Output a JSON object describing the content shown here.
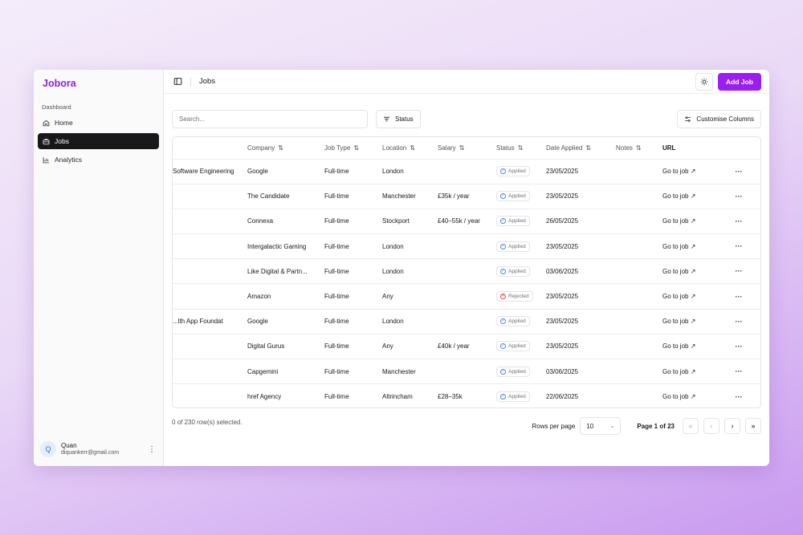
{
  "app": {
    "brand": "Jobora",
    "accent": "#9a1ef0"
  },
  "sidebar": {
    "section_label": "Dashboard",
    "items": [
      {
        "label": "Home",
        "icon": "home-icon"
      },
      {
        "label": "Jobs",
        "icon": "briefcase-icon",
        "active": true
      },
      {
        "label": "Analytics",
        "icon": "chart-icon"
      }
    ],
    "user": {
      "initial": "Q",
      "name": "Quan",
      "email": "diquankerr@gmail.com"
    }
  },
  "header": {
    "title": "Jobs",
    "add_label": "Add Job"
  },
  "toolbar": {
    "search_placeholder": "Search...",
    "status_label": "Status",
    "customise_label": "Customise Columns"
  },
  "table": {
    "columns": [
      "",
      "Company",
      "Job Type",
      "Location",
      "Salary",
      "Status",
      "Date Applied",
      "Notes",
      "URL",
      ""
    ],
    "rows": [
      {
        "title": "Software Engineering",
        "company": "Google",
        "job_type": "Full-time",
        "location": "London",
        "salary": "",
        "status": "Applied",
        "date": "23/05/2025",
        "notes": "",
        "url": "Go to job ↗"
      },
      {
        "title": "",
        "company": "The Candidate",
        "job_type": "Full-time",
        "location": "Manchester",
        "salary": "£35k / year",
        "status": "Applied",
        "date": "23/05/2025",
        "notes": "",
        "url": "Go to job ↗"
      },
      {
        "title": "",
        "company": "Connexa",
        "job_type": "Full-time",
        "location": "Stockport",
        "salary": "£40–55k / year",
        "status": "Applied",
        "date": "26/05/2025",
        "notes": "",
        "url": "Go to job ↗"
      },
      {
        "title": "",
        "company": "Intergalactic Gaming",
        "job_type": "Full-time",
        "location": "London",
        "salary": "",
        "status": "Applied",
        "date": "23/05/2025",
        "notes": "",
        "url": "Go to job ↗"
      },
      {
        "title": "",
        "company": "Like Digital & Partn...",
        "job_type": "Full-time",
        "location": "London",
        "salary": "",
        "status": "Applied",
        "date": "03/06/2025",
        "notes": "",
        "url": "Go to job ↗"
      },
      {
        "title": "",
        "company": "Amazon",
        "job_type": "Full-time",
        "location": "Any",
        "salary": "",
        "status": "Rejected",
        "date": "23/05/2025",
        "notes": "",
        "url": "Go to job ↗"
      },
      {
        "title": "lth App Foundat...",
        "company": "Google",
        "job_type": "Full-time",
        "location": "London",
        "salary": "",
        "status": "Applied",
        "date": "23/05/2025",
        "notes": "",
        "url": "Go to job ↗"
      },
      {
        "title": "",
        "company": "Digital Gurus",
        "job_type": "Full-time",
        "location": "Any",
        "salary": "£40k / year",
        "status": "Applied",
        "date": "23/05/2025",
        "notes": "",
        "url": "Go to job ↗"
      },
      {
        "title": "",
        "company": "Capgemini",
        "job_type": "Full-time",
        "location": "Manchester",
        "salary": "",
        "status": "Applied",
        "date": "03/06/2025",
        "notes": "",
        "url": "Go to job ↗"
      },
      {
        "title": "",
        "company": "href Agency",
        "job_type": "Full-time",
        "location": "Altrincham",
        "salary": "£28–35k",
        "status": "Applied",
        "date": "22/06/2025",
        "notes": "",
        "url": "Go to job ↗"
      }
    ]
  },
  "footer": {
    "selection": "0 of 230 row(s) selected.",
    "rows_per_page_label": "Rows per page",
    "rows_per_page": "10",
    "page_info": "Page 1 of 23"
  }
}
